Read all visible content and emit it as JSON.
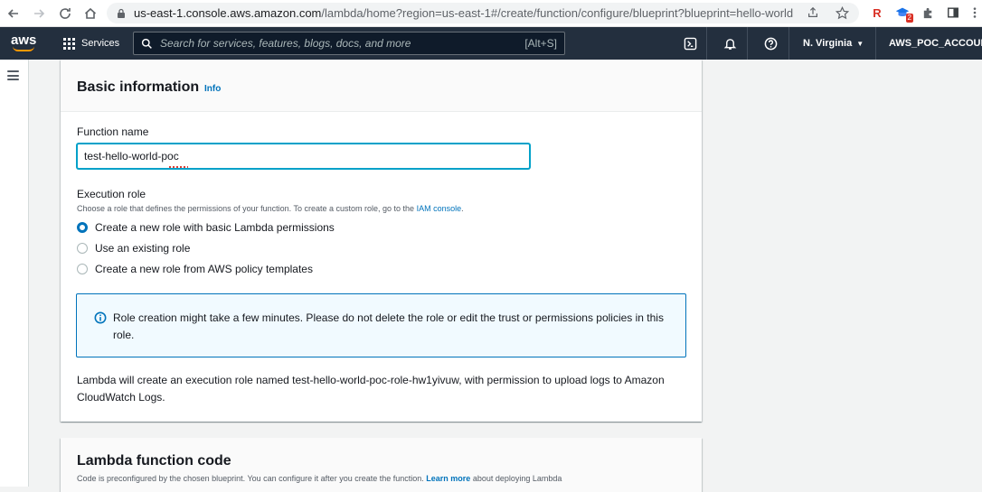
{
  "browser": {
    "url_host": "us-east-1.console.aws.amazon.com",
    "url_path": "/lambda/home?region=us-east-1#/create/function/configure/blueprint?blueprint=hello-world",
    "extension_badge": "2",
    "extension_r": "R"
  },
  "aws_nav": {
    "logo": "aws",
    "services_label": "Services",
    "search_placeholder": "Search for services, features, blogs, docs, and more",
    "search_shortcut": "[Alt+S]",
    "region": "N. Virginia",
    "account": "AWS_POC_ACCOUNT"
  },
  "basic_info": {
    "title": "Basic information",
    "info_link": "Info",
    "function_name_label": "Function name",
    "function_name_value": "test-hello-world-poc",
    "execution_role_label": "Execution role",
    "execution_role_desc": "Choose a role that defines the permissions of your function. To create a custom role, go to the",
    "iam_console_link": "IAM console",
    "role_options": [
      {
        "label": "Create a new role with basic Lambda permissions",
        "checked": true
      },
      {
        "label": "Use an existing role",
        "checked": false
      },
      {
        "label": "Create a new role from AWS policy templates",
        "checked": false
      }
    ],
    "alert_text": "Role creation might take a few minutes. Please do not delete the role or edit the trust or permissions policies in this role.",
    "create_note": "Lambda will create an execution role named test-hello-world-poc-role-hw1yivuw, with permission to upload logs to Amazon CloudWatch Logs."
  },
  "function_code": {
    "title": "Lambda function code",
    "desc": "Code is preconfigured by the chosen blueprint. You can configure it after you create the function.",
    "learn_more": "Learn more",
    "desc_tail": "about deploying Lambda"
  },
  "colors": {
    "nav_bg": "#232f3e",
    "link": "#0073bb",
    "alert_bg": "#f1faff",
    "smile": "#ff9900"
  }
}
